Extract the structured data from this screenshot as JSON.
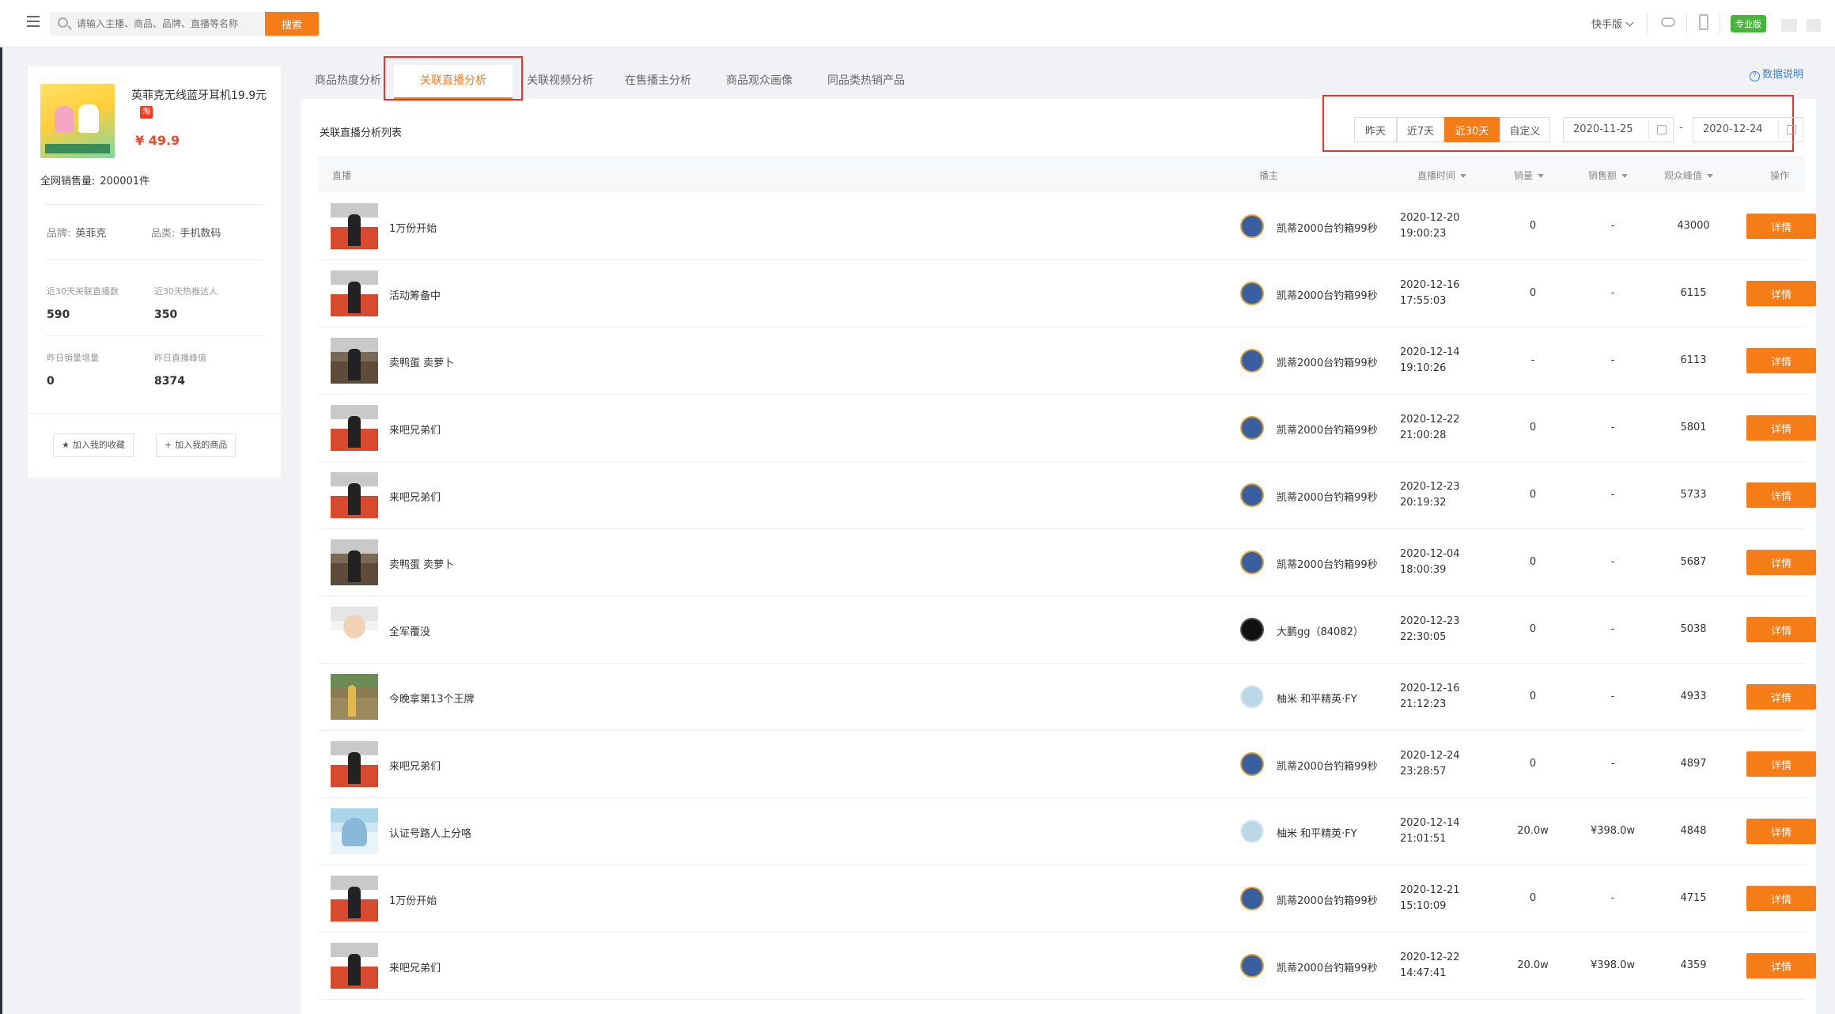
{
  "topbar": {
    "search_placeholder": "请输入主播、商品、品牌、直播等名称",
    "search_button": "搜索",
    "platform": "快手版",
    "pro_badge": "专业版"
  },
  "product": {
    "title": "英菲克无线蓝牙耳机19.9元",
    "store_icon": "淘",
    "price": "¥ 49.9",
    "total_sales_label": "全网销售量:",
    "total_sales_value": "200001件",
    "brand_label": "品牌:",
    "brand_value": "英菲克",
    "category_label": "品类:",
    "category_value": "手机数码",
    "stats": [
      {
        "label": "近30天关联直播数",
        "value": "590"
      },
      {
        "label": "近30天热推达人",
        "value": "350"
      },
      {
        "label": "昨日销量增量",
        "value": "0"
      },
      {
        "label": "昨日直播峰值",
        "value": "8374"
      }
    ],
    "fav_button": "加入我的收藏",
    "add_button": "加入我的商品"
  },
  "tabs": [
    "商品热度分析",
    "关联直播分析",
    "关联视频分析",
    "在售播主分析",
    "商品观众画像",
    "同品类热销产品"
  ],
  "help_text": "数据说明",
  "list_title": "关联直播分析列表",
  "range_buttons": [
    "昨天",
    "近7天",
    "近30天",
    "自定义"
  ],
  "date_start": "2020-11-25",
  "date_end": "2020-12-24",
  "date_dash": "-",
  "columns": [
    "直播",
    "播主",
    "直播时间",
    "销量",
    "销售额",
    "观众峰值",
    "操作"
  ],
  "detail_label": "详情",
  "rows": [
    {
      "title": "1万份开始",
      "anchor": "凯蒂2000台钓箱99秒",
      "date": "2020-12-20",
      "time": "19:00:23",
      "sales": "0",
      "amount": "-",
      "peak": "43000"
    },
    {
      "title": "活动筹备中",
      "anchor": "凯蒂2000台钓箱99秒",
      "date": "2020-12-16",
      "time": "17:55:03",
      "sales": "0",
      "amount": "-",
      "peak": "6115"
    },
    {
      "title": "卖鸭蛋 卖萝卜",
      "anchor": "凯蒂2000台钓箱99秒",
      "date": "2020-12-14",
      "time": "19:10:26",
      "sales": "-",
      "amount": "-",
      "peak": "6113"
    },
    {
      "title": "来吧兄弟们",
      "anchor": "凯蒂2000台钓箱99秒",
      "date": "2020-12-22",
      "time": "21:00:28",
      "sales": "0",
      "amount": "-",
      "peak": "5801"
    },
    {
      "title": "来吧兄弟们",
      "anchor": "凯蒂2000台钓箱99秒",
      "date": "2020-12-23",
      "time": "20:19:32",
      "sales": "0",
      "amount": "-",
      "peak": "5733"
    },
    {
      "title": "卖鸭蛋 卖萝卜",
      "anchor": "凯蒂2000台钓箱99秒",
      "date": "2020-12-04",
      "time": "18:00:39",
      "sales": "0",
      "amount": "-",
      "peak": "5687"
    },
    {
      "title": "全军覆没",
      "anchor": "大鹏gg（84082）",
      "date": "2020-12-23",
      "time": "22:30:05",
      "sales": "0",
      "amount": "-",
      "peak": "5038"
    },
    {
      "title": "今晚拿第13个王牌",
      "anchor": "柚米 和平精英·FY",
      "date": "2020-12-16",
      "time": "21:12:23",
      "sales": "0",
      "amount": "-",
      "peak": "4933"
    },
    {
      "title": "来吧兄弟们",
      "anchor": "凯蒂2000台钓箱99秒",
      "date": "2020-12-24",
      "time": "23:28:57",
      "sales": "0",
      "amount": "-",
      "peak": "4897"
    },
    {
      "title": "认证号路人上分咯",
      "anchor": "柚米 和平精英·FY",
      "date": "2020-12-14",
      "time": "21:01:51",
      "sales": "20.0w",
      "amount": "¥398.0w",
      "peak": "4848"
    },
    {
      "title": "1万份开始",
      "anchor": "凯蒂2000台钓箱99秒",
      "date": "2020-12-21",
      "time": "15:10:09",
      "sales": "0",
      "amount": "-",
      "peak": "4715"
    },
    {
      "title": "来吧兄弟们",
      "anchor": "凯蒂2000台钓箱99秒",
      "date": "2020-12-22",
      "time": "14:47:41",
      "sales": "20.0w",
      "amount": "¥398.0w",
      "peak": "4359"
    }
  ]
}
